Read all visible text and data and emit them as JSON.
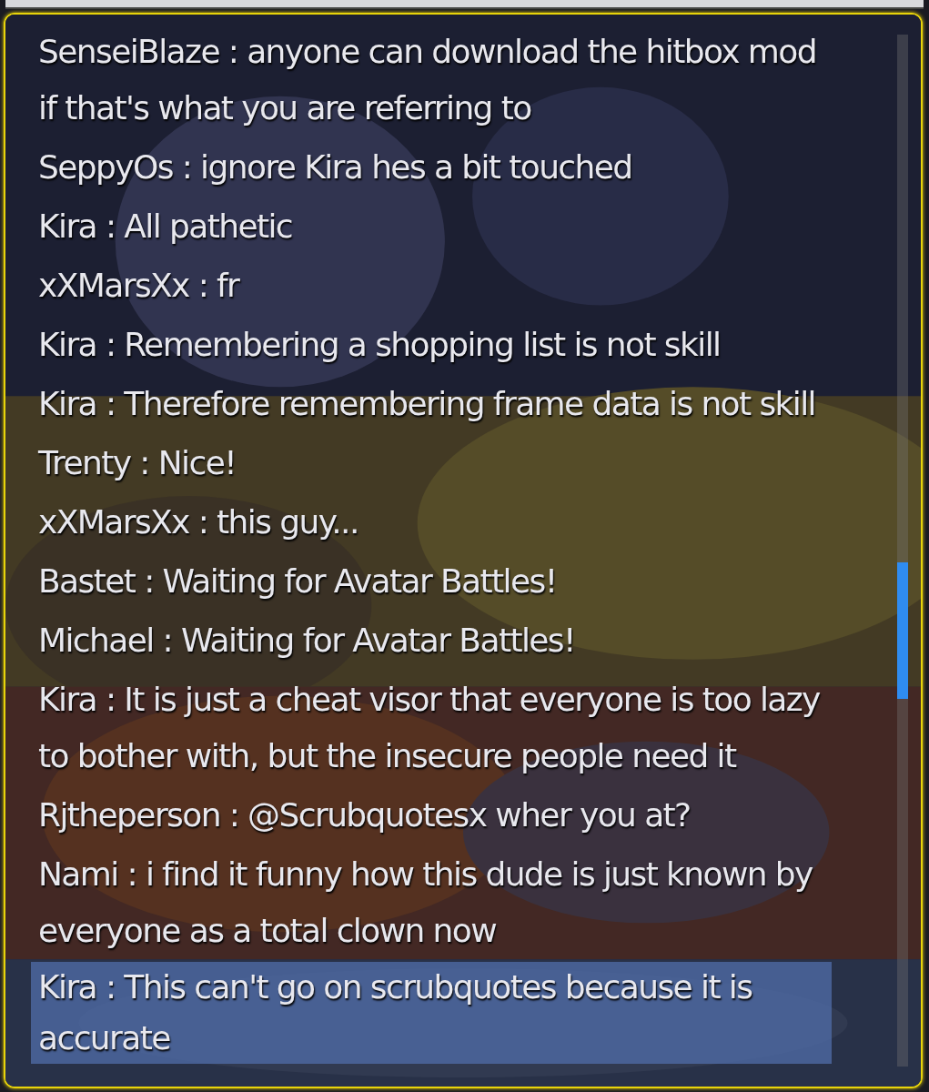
{
  "messages": [
    {
      "text": "SenseiBlaze : anyone can download the hitbox mod if that's what you are referring to",
      "selected": false
    },
    {
      "text": "SeppyOs : ignore Kira hes a bit touched",
      "selected": false
    },
    {
      "text": "Kira : All pathetic",
      "selected": false
    },
    {
      "text": "xXMarsXx : fr",
      "selected": false
    },
    {
      "text": "Kira : Remembering a shopping list is not skill",
      "selected": false
    },
    {
      "text": "Kira : Therefore remembering frame data is not skill",
      "selected": false
    },
    {
      "text": "Trenty : Nice!",
      "selected": false
    },
    {
      "text": "xXMarsXx : this guy...",
      "selected": false
    },
    {
      "text": "Bastet : Waiting for Avatar Battles!",
      "selected": false
    },
    {
      "text": "Michael : Waiting for Avatar Battles!",
      "selected": false
    },
    {
      "text": "Kira : It is just a cheat visor that everyone is too lazy to bother with, but the insecure people need it",
      "selected": false
    },
    {
      "text": "Rjtheperson : @Scrubquotesx wher you at?",
      "selected": false
    },
    {
      "text": "Nami : i find it funny how this dude is just known by everyone as a total clown now",
      "selected": false
    },
    {
      "text": "Kira : This can't go on scrubquotes because it is accurate",
      "selected": true
    }
  ]
}
